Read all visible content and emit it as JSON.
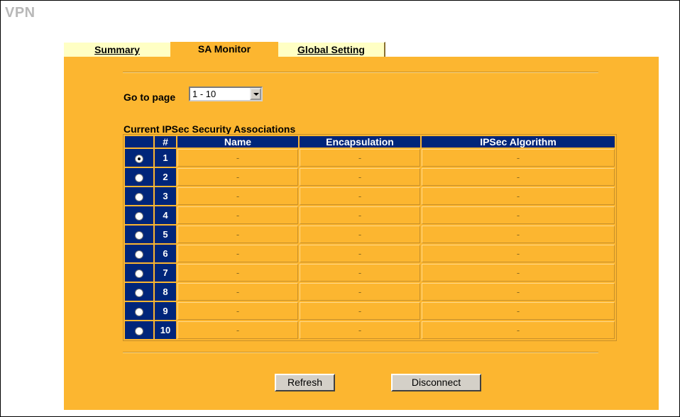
{
  "page": {
    "title": "VPN"
  },
  "tabs": [
    {
      "label": "Summary",
      "active": false
    },
    {
      "label": "SA Monitor",
      "active": true
    },
    {
      "label": "Global Setting",
      "active": false
    }
  ],
  "goto": {
    "label": "Go to page",
    "selected": "1 - 10"
  },
  "table": {
    "title": "Current IPSec Security Associations",
    "columns": [
      "",
      "#",
      "Name",
      "Encapsulation",
      "IPSec Algorithm"
    ],
    "rows": [
      {
        "num": "1",
        "name": "-",
        "encapsulation": "-",
        "algorithm": "-",
        "selected": true
      },
      {
        "num": "2",
        "name": "-",
        "encapsulation": "-",
        "algorithm": "-",
        "selected": false
      },
      {
        "num": "3",
        "name": "-",
        "encapsulation": "-",
        "algorithm": "-",
        "selected": false
      },
      {
        "num": "4",
        "name": "-",
        "encapsulation": "-",
        "algorithm": "-",
        "selected": false
      },
      {
        "num": "5",
        "name": "-",
        "encapsulation": "-",
        "algorithm": "-",
        "selected": false
      },
      {
        "num": "6",
        "name": "-",
        "encapsulation": "-",
        "algorithm": "-",
        "selected": false
      },
      {
        "num": "7",
        "name": "-",
        "encapsulation": "-",
        "algorithm": "-",
        "selected": false
      },
      {
        "num": "8",
        "name": "-",
        "encapsulation": "-",
        "algorithm": "-",
        "selected": false
      },
      {
        "num": "9",
        "name": "-",
        "encapsulation": "-",
        "algorithm": "-",
        "selected": false
      },
      {
        "num": "10",
        "name": "-",
        "encapsulation": "-",
        "algorithm": "-",
        "selected": false
      }
    ]
  },
  "buttons": {
    "refresh": "Refresh",
    "disconnect": "Disconnect"
  },
  "colors": {
    "panel": "#fcb630",
    "tab_inactive": "#ffffc4",
    "header_navy": "#00257a",
    "title_gray": "#b8b8b8"
  }
}
